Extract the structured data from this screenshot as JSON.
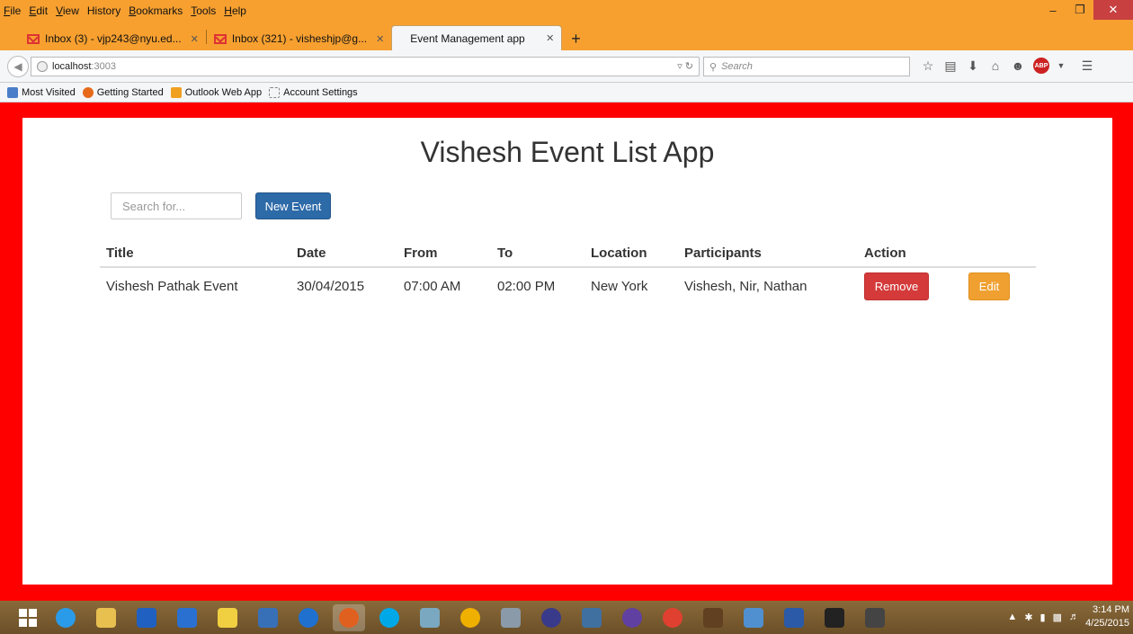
{
  "browser": {
    "menu": [
      {
        "label": "File",
        "u": "F",
        "rest": "ile"
      },
      {
        "label": "Edit",
        "u": "E",
        "rest": "dit"
      },
      {
        "label": "View",
        "u": "V",
        "rest": "iew"
      },
      {
        "label": "History",
        "u": "H",
        "rest": "istory"
      },
      {
        "label": "Bookmarks",
        "u": "B",
        "rest": "ookmarks"
      },
      {
        "label": "Tools",
        "u": "T",
        "rest": "ools"
      },
      {
        "label": "Help",
        "u": "H",
        "rest": "elp"
      }
    ],
    "tabs": [
      {
        "label": "Inbox (3) - vjp243@nyu.ed...",
        "icon": "gmail-icon"
      },
      {
        "label": "Inbox (321) - visheshjp@g...",
        "icon": "gmail-icon"
      },
      {
        "label": "Event Management app",
        "icon": ""
      }
    ],
    "url_host": "localhost",
    "url_port": ":3003",
    "search_placeholder": "Search",
    "bookmarks": [
      "Most Visited",
      "Getting Started",
      "Outlook Web App",
      "Account Settings"
    ]
  },
  "app": {
    "title": "Vishesh Event List App",
    "search_placeholder": "Search for...",
    "new_event_label": "New Event",
    "columns": [
      "Title",
      "Date",
      "From",
      "To",
      "Location",
      "Participants",
      "Action"
    ],
    "rows": [
      {
        "title": "Vishesh Pathak Event",
        "date": "30/04/2015",
        "from": "07:00 AM",
        "to": "02:00 PM",
        "location": "New York",
        "participants": "Vishesh, Nir, Nathan",
        "remove_label": "Remove",
        "edit_label": "Edit"
      }
    ]
  },
  "taskbar": {
    "time": "3:14 PM",
    "date": "4/25/2015"
  },
  "colors": {
    "frame": "#ff0000",
    "primary": "#2d6aa8",
    "danger": "#d43a3a",
    "warning": "#f0a030",
    "titlebar": "#f7a030"
  }
}
